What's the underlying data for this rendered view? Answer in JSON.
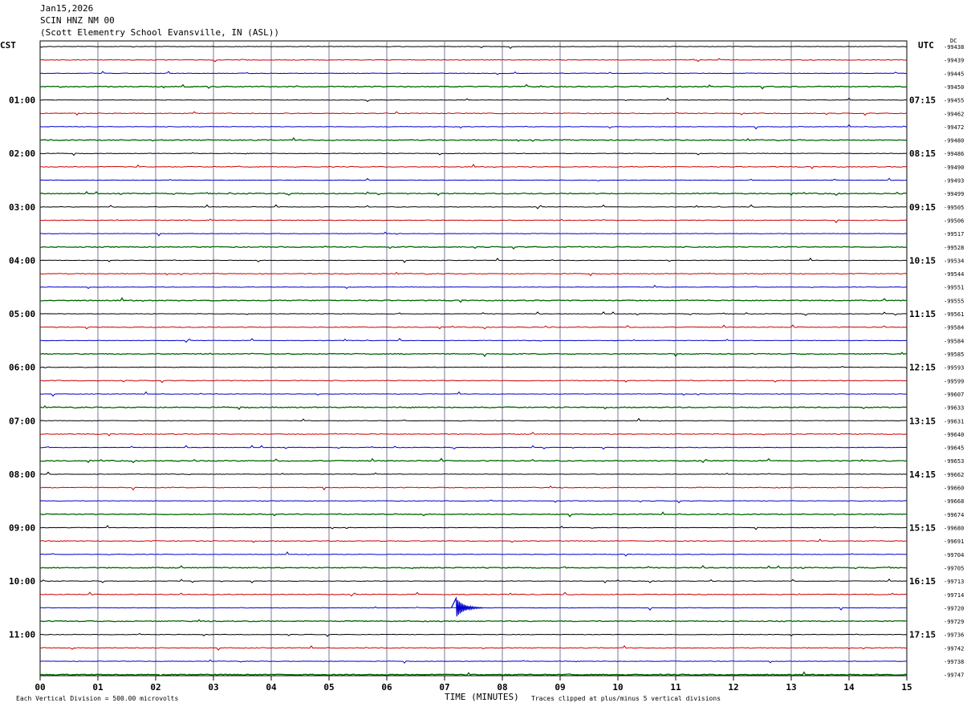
{
  "header": {
    "date": "Jan15,2026",
    "station": "SCIN HNZ NM 00",
    "location": "(Scott Elementry School Evansville, IN (ASL))"
  },
  "left_zone": "CST",
  "right_zone": "UTC",
  "dc_label": "DC",
  "footer": {
    "scale": "Each Vertical Division =  500.00 microvolts",
    "xlabel": "TIME (MINUTES)",
    "clip_note": "Traces clipped at plus/minus 5 vertical divisions"
  },
  "colors": {
    "trace1": "#000000",
    "trace2": "#cc0000",
    "trace3": "#0000cc",
    "trace4": "#006600",
    "grid": "#7a7a9a"
  },
  "chart_data": {
    "type": "line",
    "title": "SCIN HNZ NM 00",
    "xlabel": "TIME (MINUTES)",
    "xlim": [
      0,
      15
    ],
    "x_ticks": [
      "00",
      "01",
      "02",
      "03",
      "04",
      "05",
      "06",
      "07",
      "08",
      "09",
      "10",
      "11",
      "12",
      "13",
      "14",
      "15"
    ],
    "rows_per_hour": 4,
    "minutes_per_row": 15,
    "left_hour_labels": [
      "01:00",
      "02:00",
      "03:00",
      "04:00",
      "05:00",
      "06:00",
      "07:00",
      "08:00",
      "09:00",
      "10:00",
      "11:00"
    ],
    "right_hour_labels": [
      "07:15",
      "08:15",
      "09:15",
      "10:15",
      "11:15",
      "12:15",
      "13:15",
      "14:15",
      "15:15",
      "16:15",
      "17:15"
    ],
    "dc_offsets": [
      "-99438",
      "-99439",
      "-99445",
      "-99450",
      "-99455",
      "-99462",
      "-99472",
      "-99480",
      "-99486",
      "-99490",
      "-99493",
      "-99499",
      "-99505",
      "-99506",
      "-99517",
      "-99528",
      "-99534",
      "-99544",
      "-99551",
      "-99555",
      "-99561",
      "-99584",
      "-99584",
      "-99585",
      "-99593",
      "-99599",
      "-99607",
      "-99633",
      "-99631",
      "-99640",
      "-99645",
      "-99653",
      "-99662",
      "-99660",
      "-99668",
      "-99674",
      "-99680",
      "-99691",
      "-99704",
      "-99705",
      "-99713",
      "-99714",
      "-99720",
      "-99729",
      "-99736",
      "-99742",
      "-99738",
      "-99747"
    ],
    "trace_color_cycle": [
      "black",
      "red",
      "blue",
      "green"
    ],
    "events": [
      {
        "row": 42,
        "minute": 7.2,
        "amplitude_div": 0.8,
        "note": "largest burst"
      }
    ]
  }
}
